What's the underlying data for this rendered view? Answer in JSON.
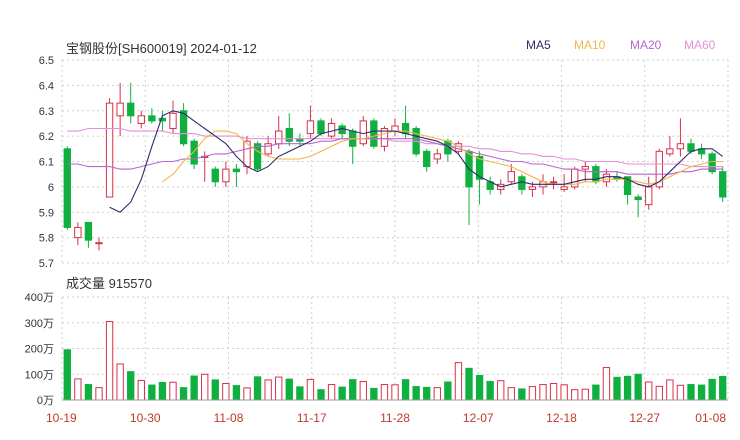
{
  "header": {
    "stock": "宝钢股份[SH600019]",
    "date": "2024-01-12"
  },
  "legend": [
    {
      "name": "MA5",
      "color": "#2d2d6b"
    },
    {
      "name": "MA10",
      "color": "#f2b64a"
    },
    {
      "name": "MA20",
      "color": "#b665d1"
    },
    {
      "name": "MA60",
      "color": "#e88fd2"
    }
  ],
  "volume_label": "成交量 915570",
  "colors": {
    "up": "#d9304a",
    "down": "#10b040",
    "grid": "#cfcfcf"
  },
  "chart_data": [
    {
      "type": "candlestick",
      "ylim": [
        5.7,
        6.5
      ],
      "yticks": [
        "6.5",
        "6.4",
        "6.3",
        "6.2",
        "6.1",
        "6",
        "5.9",
        "5.8",
        "5.7"
      ],
      "xticks": [
        "10-19",
        "10-30",
        "11-08",
        "11-17",
        "11-28",
        "12-07",
        "12-18",
        "12-27",
        "01-08"
      ],
      "candles": [
        {
          "o": 6.15,
          "c": 5.84,
          "h": 6.16,
          "l": 5.83
        },
        {
          "o": 5.8,
          "c": 5.84,
          "h": 5.86,
          "l": 5.77
        },
        {
          "o": 5.86,
          "c": 5.79,
          "h": 5.86,
          "l": 5.76
        },
        {
          "o": 5.78,
          "c": 5.78,
          "h": 5.8,
          "l": 5.75
        },
        {
          "o": 5.96,
          "c": 6.33,
          "h": 6.35,
          "l": 5.96
        },
        {
          "o": 6.28,
          "c": 6.33,
          "h": 6.41,
          "l": 6.2
        },
        {
          "o": 6.33,
          "c": 6.28,
          "h": 6.41,
          "l": 6.25
        },
        {
          "o": 6.25,
          "c": 6.28,
          "h": 6.3,
          "l": 6.23
        },
        {
          "o": 6.28,
          "c": 6.26,
          "h": 6.31,
          "l": 6.25
        },
        {
          "o": 6.27,
          "c": 6.26,
          "h": 6.3,
          "l": 6.22
        },
        {
          "o": 6.23,
          "c": 6.29,
          "h": 6.34,
          "l": 6.21
        },
        {
          "o": 6.3,
          "c": 6.17,
          "h": 6.33,
          "l": 6.16
        },
        {
          "o": 6.18,
          "c": 6.09,
          "h": 6.19,
          "l": 6.07
        },
        {
          "o": 6.12,
          "c": 6.12,
          "h": 6.14,
          "l": 6.02
        },
        {
          "o": 6.07,
          "c": 6.02,
          "h": 6.08,
          "l": 6.0
        },
        {
          "o": 6.02,
          "c": 6.07,
          "h": 6.1,
          "l": 6.0
        },
        {
          "o": 6.07,
          "c": 6.06,
          "h": 6.09,
          "l": 6.0
        },
        {
          "o": 6.08,
          "c": 6.18,
          "h": 6.2,
          "l": 6.05
        },
        {
          "o": 6.17,
          "c": 6.07,
          "h": 6.18,
          "l": 6.06
        },
        {
          "o": 6.13,
          "c": 6.17,
          "h": 6.2,
          "l": 6.12
        },
        {
          "o": 6.17,
          "c": 6.22,
          "h": 6.28,
          "l": 6.15
        },
        {
          "o": 6.23,
          "c": 6.18,
          "h": 6.29,
          "l": 6.16
        },
        {
          "o": 6.19,
          "c": 6.18,
          "h": 6.21,
          "l": 6.16
        },
        {
          "o": 6.21,
          "c": 6.26,
          "h": 6.32,
          "l": 6.19
        },
        {
          "o": 6.26,
          "c": 6.21,
          "h": 6.27,
          "l": 6.2
        },
        {
          "o": 6.2,
          "c": 6.25,
          "h": 6.27,
          "l": 6.19
        },
        {
          "o": 6.24,
          "c": 6.21,
          "h": 6.25,
          "l": 6.19
        },
        {
          "o": 6.22,
          "c": 6.16,
          "h": 6.23,
          "l": 6.09
        },
        {
          "o": 6.17,
          "c": 6.26,
          "h": 6.28,
          "l": 6.16
        },
        {
          "o": 6.26,
          "c": 6.16,
          "h": 6.27,
          "l": 6.15
        },
        {
          "o": 6.16,
          "c": 6.23,
          "h": 6.24,
          "l": 6.14
        },
        {
          "o": 6.22,
          "c": 6.24,
          "h": 6.27,
          "l": 6.2
        },
        {
          "o": 6.25,
          "c": 6.21,
          "h": 6.32,
          "l": 6.19
        },
        {
          "o": 6.23,
          "c": 6.13,
          "h": 6.24,
          "l": 6.12
        },
        {
          "o": 6.14,
          "c": 6.08,
          "h": 6.15,
          "l": 6.06
        },
        {
          "o": 6.11,
          "c": 6.13,
          "h": 6.15,
          "l": 6.09
        },
        {
          "o": 6.18,
          "c": 6.13,
          "h": 6.19,
          "l": 6.1
        },
        {
          "o": 6.14,
          "c": 6.17,
          "h": 6.18,
          "l": 6.13
        },
        {
          "o": 6.14,
          "c": 6.0,
          "h": 6.15,
          "l": 5.85
        },
        {
          "o": 6.12,
          "c": 6.03,
          "h": 6.14,
          "l": 5.93
        },
        {
          "o": 6.02,
          "c": 5.99,
          "h": 6.04,
          "l": 5.97
        },
        {
          "o": 5.99,
          "c": 6.01,
          "h": 6.03,
          "l": 5.97
        },
        {
          "o": 6.02,
          "c": 6.06,
          "h": 6.09,
          "l": 6.01
        },
        {
          "o": 6.04,
          "c": 5.99,
          "h": 6.05,
          "l": 5.97
        },
        {
          "o": 5.99,
          "c": 6.0,
          "h": 6.02,
          "l": 5.96
        },
        {
          "o": 6.0,
          "c": 6.02,
          "h": 6.05,
          "l": 5.97
        },
        {
          "o": 6.02,
          "c": 6.02,
          "h": 6.04,
          "l": 5.99
        },
        {
          "o": 5.99,
          "c": 6.0,
          "h": 6.05,
          "l": 5.98
        },
        {
          "o": 6.0,
          "c": 6.07,
          "h": 6.08,
          "l": 5.99
        },
        {
          "o": 6.07,
          "c": 6.08,
          "h": 6.1,
          "l": 6.02
        },
        {
          "o": 6.08,
          "c": 6.02,
          "h": 6.09,
          "l": 6.01
        },
        {
          "o": 6.02,
          "c": 6.05,
          "h": 6.07,
          "l": 6.0
        },
        {
          "o": 6.04,
          "c": 6.03,
          "h": 6.06,
          "l": 6.02
        },
        {
          "o": 6.04,
          "c": 5.97,
          "h": 6.04,
          "l": 5.93
        },
        {
          "o": 5.96,
          "c": 5.95,
          "h": 5.97,
          "l": 5.88
        },
        {
          "o": 5.93,
          "c": 6.0,
          "h": 6.04,
          "l": 5.91
        },
        {
          "o": 6.0,
          "c": 6.14,
          "h": 6.15,
          "l": 5.99
        },
        {
          "o": 6.13,
          "c": 6.15,
          "h": 6.2,
          "l": 6.12
        },
        {
          "o": 6.15,
          "c": 6.17,
          "h": 6.27,
          "l": 6.12
        },
        {
          "o": 6.17,
          "c": 6.14,
          "h": 6.19,
          "l": 6.13
        },
        {
          "o": 6.15,
          "c": 6.13,
          "h": 6.17,
          "l": 6.11
        },
        {
          "o": 6.13,
          "c": 6.06,
          "h": 6.14,
          "l": 6.05
        },
        {
          "o": 6.06,
          "c": 5.96,
          "h": 6.08,
          "l": 5.94
        }
      ],
      "ma5": [
        null,
        null,
        null,
        null,
        5.92,
        5.9,
        5.94,
        6.03,
        6.16,
        6.28,
        6.3,
        6.29,
        6.26,
        6.23,
        6.2,
        6.17,
        6.12,
        6.08,
        6.06,
        6.08,
        6.12,
        6.14,
        6.16,
        6.18,
        6.21,
        6.22,
        6.23,
        6.22,
        6.21,
        6.22,
        6.22,
        6.22,
        6.21,
        6.2,
        6.19,
        6.18,
        6.16,
        6.13,
        6.07,
        6.04,
        6.02,
        6.0,
        6.01,
        6.02,
        6.01,
        6.01,
        6.01,
        6.01,
        6.02,
        6.03,
        6.03,
        6.04,
        6.04,
        6.03,
        6.01,
        6.0,
        6.02,
        6.06,
        6.1,
        6.14,
        6.15,
        6.15,
        6.12
      ],
      "ma10": [
        null,
        null,
        null,
        null,
        null,
        null,
        null,
        null,
        null,
        6.02,
        6.05,
        6.1,
        6.14,
        6.19,
        6.22,
        6.22,
        6.21,
        6.17,
        6.14,
        6.12,
        6.11,
        6.11,
        6.11,
        6.12,
        6.14,
        6.16,
        6.18,
        6.19,
        6.19,
        6.2,
        6.21,
        6.22,
        6.22,
        6.21,
        6.2,
        6.19,
        6.18,
        6.16,
        6.13,
        6.11,
        6.1,
        6.09,
        6.08,
        6.06,
        6.04,
        6.02,
        6.01,
        6.01,
        6.01,
        6.02,
        6.02,
        6.03,
        6.03,
        6.03,
        6.02,
        6.01,
        6.02,
        6.04,
        6.06,
        6.08,
        6.09,
        6.1,
        6.1
      ],
      "ma20": [
        6.09,
        6.09,
        6.08,
        6.08,
        6.08,
        6.07,
        6.07,
        6.08,
        6.09,
        6.1,
        6.1,
        6.11,
        6.11,
        6.12,
        6.13,
        6.13,
        6.14,
        6.15,
        6.16,
        6.16,
        6.17,
        6.17,
        6.17,
        6.17,
        6.18,
        6.18,
        6.19,
        6.19,
        6.19,
        6.19,
        6.19,
        6.19,
        6.19,
        6.19,
        6.18,
        6.17,
        6.16,
        6.15,
        6.14,
        6.13,
        6.12,
        6.11,
        6.1,
        6.1,
        6.09,
        6.09,
        6.08,
        6.07,
        6.07,
        6.06,
        6.06,
        6.06,
        6.06,
        6.05,
        6.05,
        6.05,
        6.05,
        6.05,
        6.06,
        6.06,
        6.07,
        6.07,
        6.07
      ],
      "ma60": [
        6.22,
        6.22,
        6.23,
        6.23,
        6.23,
        6.23,
        6.22,
        6.22,
        6.22,
        6.22,
        6.21,
        6.21,
        6.21,
        6.2,
        6.2,
        6.2,
        6.2,
        6.19,
        6.19,
        6.19,
        6.19,
        6.19,
        6.19,
        6.19,
        6.19,
        6.19,
        6.19,
        6.19,
        6.19,
        6.19,
        6.19,
        6.18,
        6.18,
        6.18,
        6.17,
        6.17,
        6.16,
        6.16,
        6.16,
        6.15,
        6.15,
        6.14,
        6.14,
        6.13,
        6.13,
        6.12,
        6.12,
        6.11,
        6.11,
        6.1,
        6.1,
        6.1,
        6.1,
        6.09,
        6.09,
        6.09,
        6.09,
        6.09,
        6.09,
        6.08,
        6.08,
        6.08,
        6.08
      ]
    },
    {
      "type": "bar",
      "title": "成交量 915570",
      "ylim": [
        0,
        4000000
      ],
      "yticks": [
        "400万",
        "300万",
        "200万",
        "100万",
        "0万"
      ],
      "values": [
        1950000,
        820000,
        600000,
        480000,
        3050000,
        1400000,
        1100000,
        760000,
        580000,
        680000,
        690000,
        480000,
        930000,
        1000000,
        780000,
        640000,
        560000,
        470000,
        900000,
        780000,
        890000,
        810000,
        510000,
        800000,
        400000,
        600000,
        500000,
        790000,
        720000,
        450000,
        600000,
        590000,
        790000,
        520000,
        490000,
        480000,
        700000,
        1450000,
        1230000,
        950000,
        720000,
        750000,
        480000,
        430000,
        520000,
        600000,
        640000,
        590000,
        400000,
        420000,
        580000,
        1260000,
        880000,
        920000,
        1000000,
        700000,
        530000,
        780000,
        570000,
        600000,
        580000,
        800000,
        915570
      ]
    }
  ]
}
